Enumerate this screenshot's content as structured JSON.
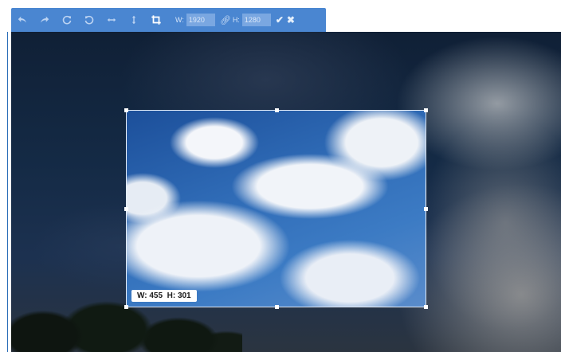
{
  "toolbar": {
    "icons": [
      "undo-icon",
      "redo-icon",
      "rotate-right-icon",
      "rotate-left-icon",
      "flip-horizontal-icon",
      "flip-vertical-icon",
      "crop-icon"
    ],
    "width_label": "W:",
    "width_value": "1920",
    "height_label": "H:",
    "height_value": "1280",
    "link_icon": "link-icon",
    "confirm_icon": "check-icon",
    "cancel_icon": "close-icon"
  },
  "crop": {
    "size_label": "W: 455  H: 301"
  },
  "colors": {
    "toolbar_bg": "#4a86d1",
    "accent_rule": "#2a6db8"
  }
}
